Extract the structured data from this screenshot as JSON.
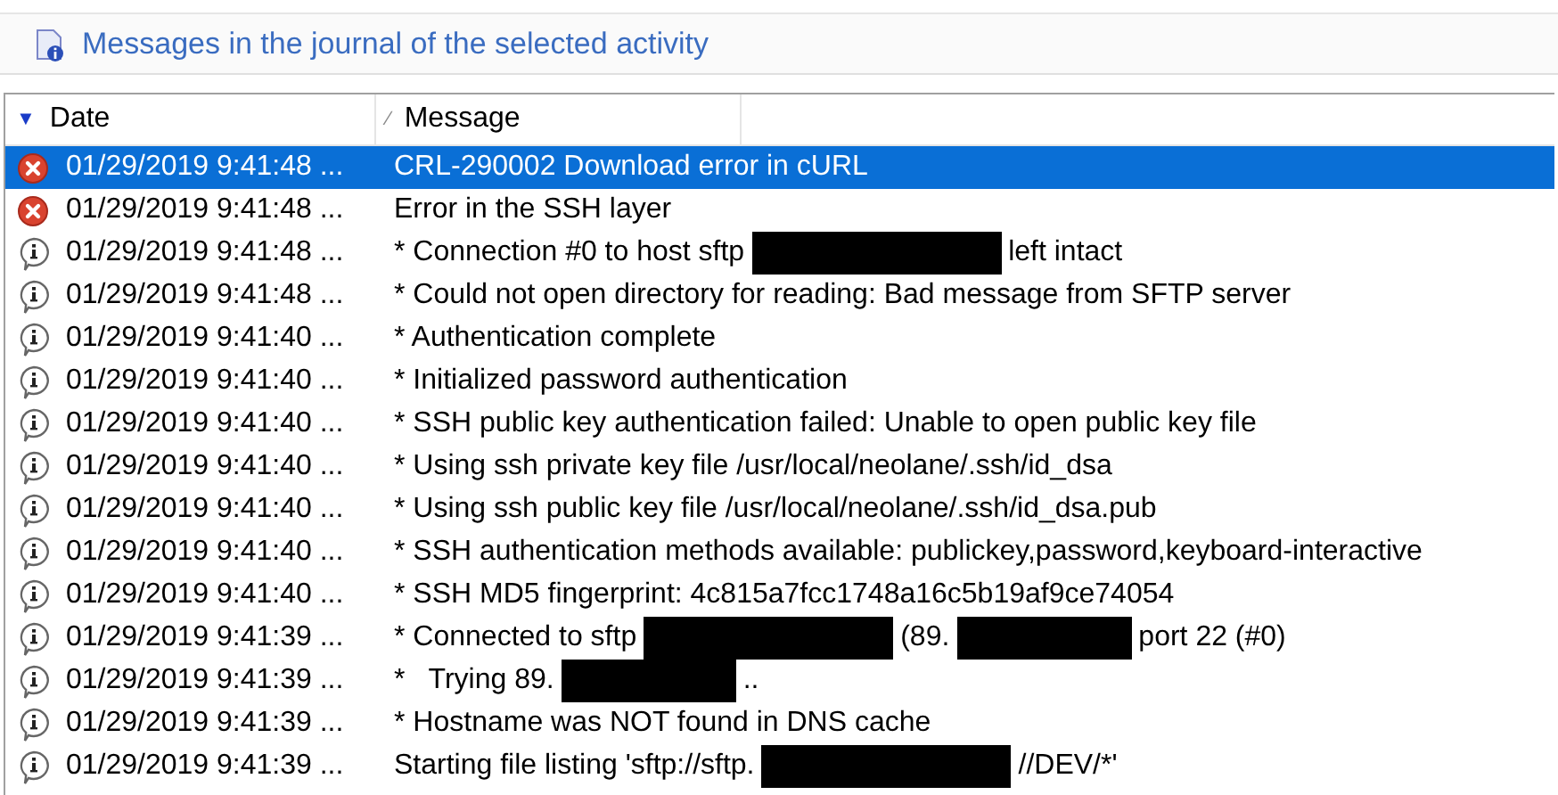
{
  "panel": {
    "title": "Messages in the journal of the selected activity"
  },
  "table": {
    "columns": [
      {
        "label": "Date",
        "sort_mark": "▼"
      },
      {
        "label": "Message",
        "sort_mark": "⁄"
      }
    ],
    "rows": [
      {
        "kind": "error",
        "selected": true,
        "date": "01/29/2019 9:41:48 ...",
        "parts": [
          {
            "kind": "text",
            "text": "CRL-290002 Download error in cURL"
          }
        ]
      },
      {
        "kind": "error",
        "selected": false,
        "date": "01/29/2019 9:41:48 ...",
        "parts": [
          {
            "kind": "text",
            "text": "Error in the SSH layer"
          }
        ]
      },
      {
        "kind": "info",
        "selected": false,
        "date": "01/29/2019 9:41:48 ...",
        "parts": [
          {
            "kind": "text",
            "text": "* Connection #0 to host sftp"
          },
          {
            "kind": "longredaction"
          },
          {
            "kind": "text",
            "text": "left intact"
          }
        ]
      },
      {
        "kind": "info",
        "selected": false,
        "date": "01/29/2019 9:41:48 ...",
        "parts": [
          {
            "kind": "text",
            "text": "* Could not open directory for reading: Bad message from SFTP server"
          }
        ]
      },
      {
        "kind": "info",
        "selected": false,
        "date": "01/29/2019 9:41:40 ...",
        "parts": [
          {
            "kind": "text",
            "text": "* Authentication complete"
          }
        ]
      },
      {
        "kind": "info",
        "selected": false,
        "date": "01/29/2019 9:41:40 ...",
        "parts": [
          {
            "kind": "text",
            "text": "* Initialized password authentication"
          }
        ]
      },
      {
        "kind": "info",
        "selected": false,
        "date": "01/29/2019 9:41:40 ...",
        "parts": [
          {
            "kind": "text",
            "text": "* SSH public key authentication failed: Unable to open public key file"
          }
        ]
      },
      {
        "kind": "info",
        "selected": false,
        "date": "01/29/2019 9:41:40 ...",
        "parts": [
          {
            "kind": "text",
            "text": "* Using ssh private key file /usr/local/neolane/.ssh/id_dsa"
          }
        ]
      },
      {
        "kind": "info",
        "selected": false,
        "date": "01/29/2019 9:41:40 ...",
        "parts": [
          {
            "kind": "text",
            "text": "* Using ssh public key file /usr/local/neolane/.ssh/id_dsa.pub"
          }
        ]
      },
      {
        "kind": "info",
        "selected": false,
        "date": "01/29/2019 9:41:40 ...",
        "parts": [
          {
            "kind": "text",
            "text": "* SSH authentication methods available: publickey,password,keyboard-interactive"
          }
        ]
      },
      {
        "kind": "info",
        "selected": false,
        "date": "01/29/2019 9:41:40 ...",
        "parts": [
          {
            "kind": "text",
            "text": "* SSH MD5 fingerprint: 4c815a7fcc1748a16c5b19af9ce74054"
          }
        ]
      },
      {
        "kind": "info",
        "selected": false,
        "date": "01/29/2019 9:41:39 ...",
        "parts": [
          {
            "kind": "text",
            "text": "* Connected to sftp"
          },
          {
            "kind": "longredaction"
          },
          {
            "kind": "text",
            "text": "(89."
          },
          {
            "kind": "shortredaction"
          },
          {
            "kind": "text",
            "text": "port 22 (#0)"
          }
        ]
      },
      {
        "kind": "info",
        "selected": false,
        "date": "01/29/2019 9:41:39 ...",
        "parts": [
          {
            "kind": "text",
            "text": "*   Trying 89."
          },
          {
            "kind": "shortredaction"
          },
          {
            "kind": "text",
            "text": ".."
          }
        ]
      },
      {
        "kind": "info",
        "selected": false,
        "date": "01/29/2019 9:41:39 ...",
        "parts": [
          {
            "kind": "text",
            "text": "* Hostname was NOT found in DNS cache"
          }
        ]
      },
      {
        "kind": "info",
        "selected": false,
        "date": "01/29/2019 9:41:39 ...",
        "parts": [
          {
            "kind": "text",
            "text": "Starting file listing 'sftp://sftp."
          },
          {
            "kind": "longredaction"
          },
          {
            "kind": "text",
            "text": "//DEV/*'"
          }
        ]
      }
    ]
  }
}
